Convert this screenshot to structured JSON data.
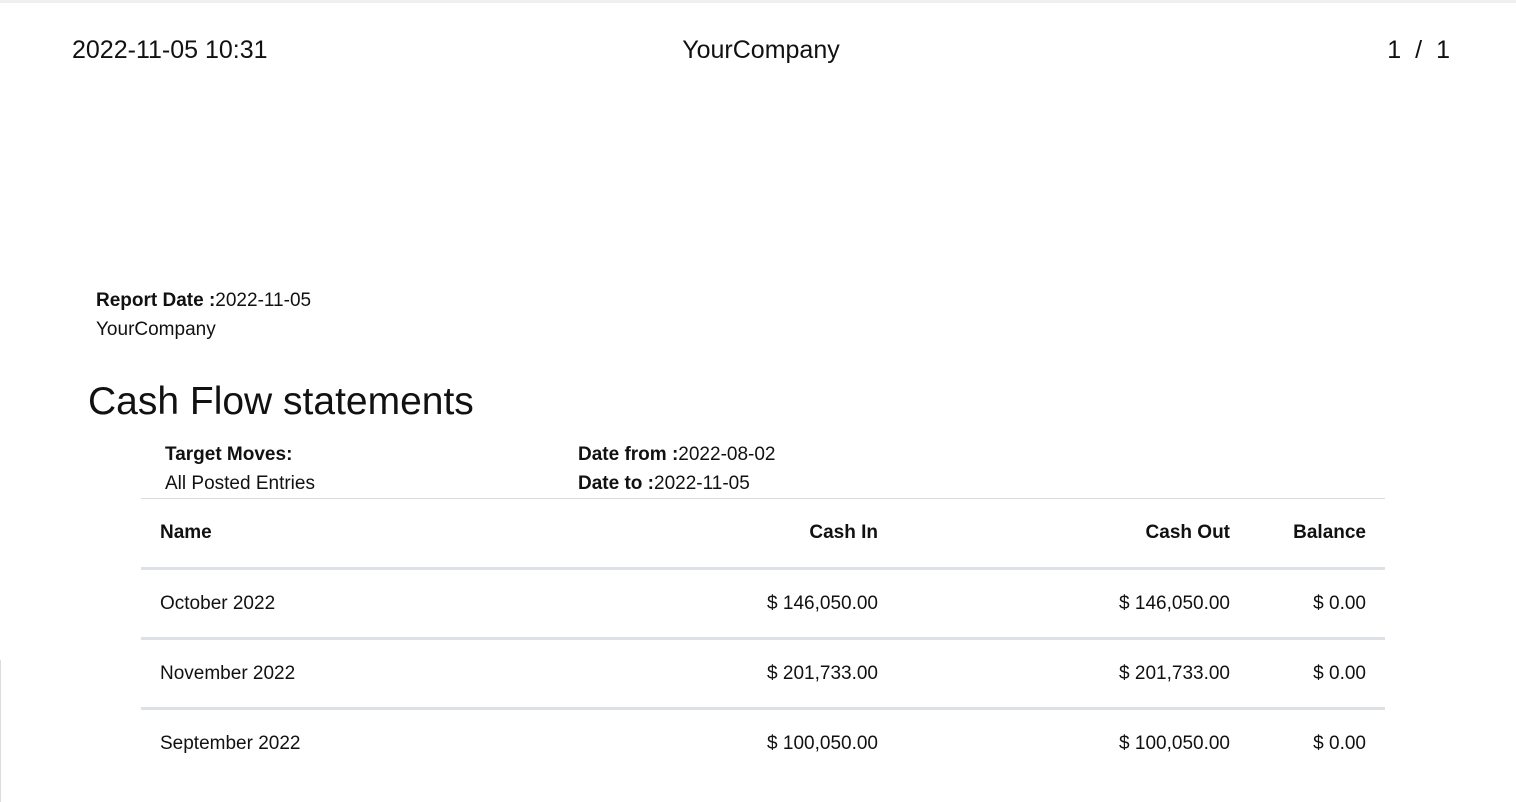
{
  "header": {
    "datetime": "2022-11-05 10:31",
    "company": "YourCompany",
    "page_current": "1",
    "page_separator": "/",
    "page_total": "1"
  },
  "report_info": {
    "report_date_label": "Report Date :",
    "report_date": "2022-11-05",
    "company": "YourCompany"
  },
  "title": "Cash Flow statements",
  "filters": {
    "target_moves_label": "Target Moves:",
    "target_moves_value": "All Posted Entries",
    "date_from_label": "Date from :",
    "date_from": "2022-08-02",
    "date_to_label": "Date to :",
    "date_to": "2022-11-05"
  },
  "table": {
    "columns": [
      "Name",
      "Cash In",
      "Cash Out",
      "Balance"
    ],
    "rows": [
      [
        "October 2022",
        "$ 146,050.00",
        "$ 146,050.00",
        "$ 0.00"
      ],
      [
        "November 2022",
        "$ 201,733.00",
        "$ 201,733.00",
        "$ 0.00"
      ],
      [
        "September 2022",
        "$ 100,050.00",
        "$ 100,050.00",
        "$ 0.00"
      ]
    ]
  }
}
